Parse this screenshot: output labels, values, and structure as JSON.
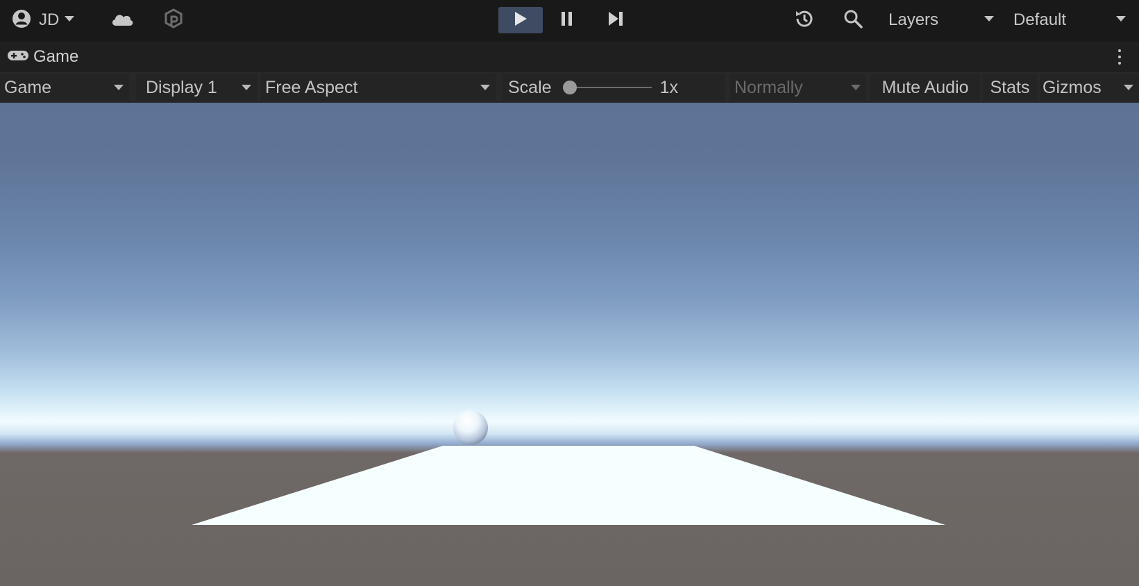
{
  "toolbar": {
    "account_name": "JD",
    "layers_label": "Layers",
    "layout_label": "Default",
    "icons": {
      "account": "account-icon",
      "cloud": "cloud-icon",
      "collab": "collab-icon",
      "play": "play-icon",
      "pause": "pause-icon",
      "step": "step-icon",
      "history": "history-icon",
      "search": "search-icon"
    }
  },
  "tab": {
    "label": "Game",
    "icon": "gamepad-icon"
  },
  "game_bar": {
    "mode": "Game",
    "display": "Display 1",
    "aspect": "Free Aspect",
    "scale_label": "Scale",
    "scale_value": "1x",
    "scale_fraction": 0,
    "play_focus": "Normally",
    "mute_audio": "Mute Audio",
    "stats": "Stats",
    "gizmos": "Gizmos"
  },
  "colors": {
    "toolbar_bg": "#191919",
    "play_active": "#3e4b62",
    "ground": "#6a6562",
    "platform": "#f6ffff"
  }
}
